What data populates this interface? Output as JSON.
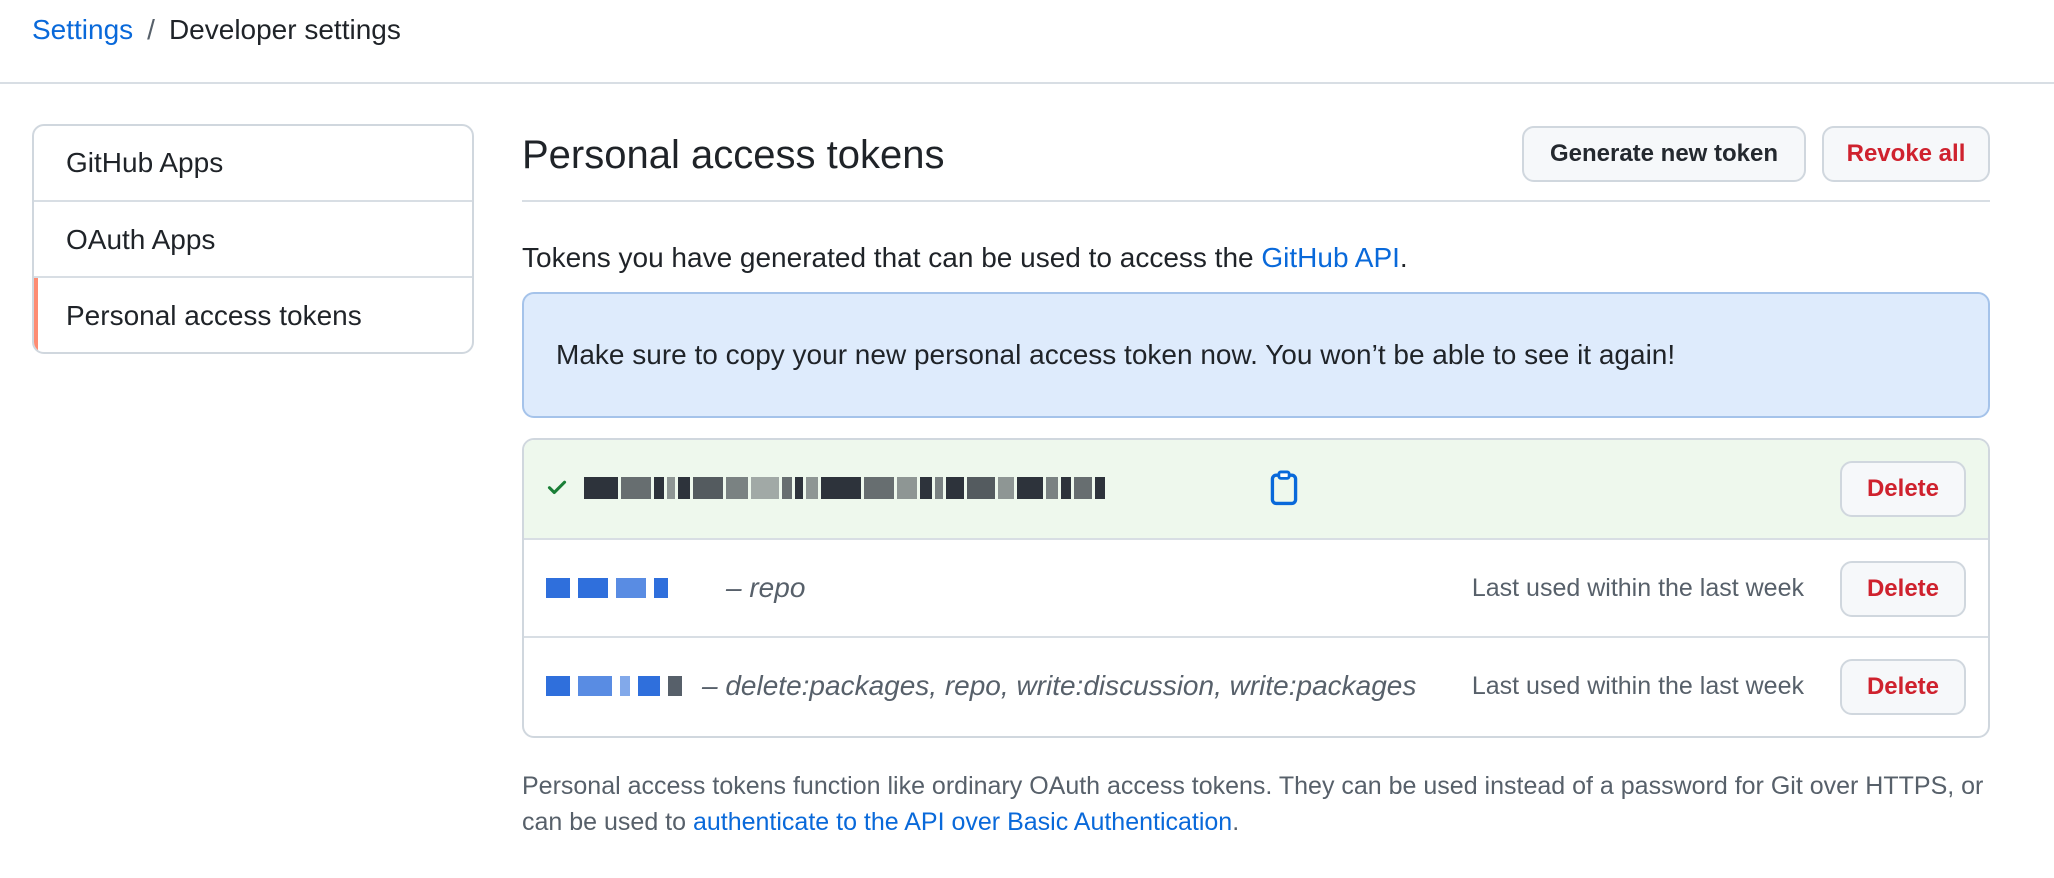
{
  "breadcrumb": {
    "root": "Settings",
    "separator": "/",
    "current": "Developer settings"
  },
  "sidebar": {
    "items": [
      {
        "label": "GitHub Apps"
      },
      {
        "label": "OAuth Apps"
      },
      {
        "label": "Personal access tokens",
        "active": true
      }
    ]
  },
  "main": {
    "title": "Personal access tokens",
    "generate_label": "Generate new token",
    "revoke_label": "Revoke all",
    "desc_prefix": "Tokens you have generated that can be used to access the ",
    "desc_link": "GitHub API",
    "desc_suffix": ".",
    "flash": "Make sure to copy your new personal access token now. You won’t be able to see it again!",
    "tokens": [
      {
        "new": true,
        "value_redacted": true,
        "delete_label": "Delete"
      },
      {
        "scopes": "– repo",
        "last_used": "Last used within the last week",
        "delete_label": "Delete"
      },
      {
        "scopes": "– delete:packages, repo, write:discussion, write:packages",
        "last_used": "Last used within the last week",
        "delete_label": "Delete"
      }
    ],
    "footnote_text": "Personal access tokens function like ordinary OAuth access tokens. They can be used instead of a password for Git over HTTPS, or can be used to ",
    "footnote_link": "authenticate to the API over Basic Authentication",
    "footnote_suffix": "."
  },
  "icons": {
    "check": "check-icon",
    "clipboard": "clipboard-icon"
  },
  "colors": {
    "link": "#0969da",
    "danger": "#cf222e",
    "active_marker": "#fd8c73",
    "flash_bg": "#deebfc",
    "new_token_bg": "#eef8ed"
  }
}
